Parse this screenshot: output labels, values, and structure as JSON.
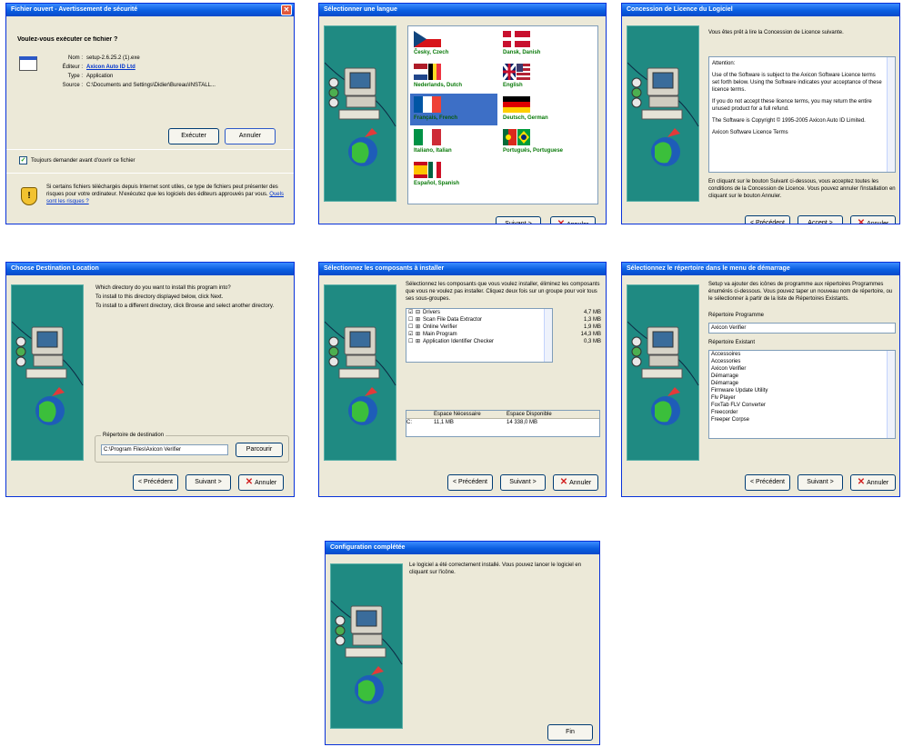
{
  "buttons": {
    "back": "< Précédent",
    "next": "Suivant >",
    "cancel": "Annuler",
    "accept": "Accept >",
    "finish": "Fin",
    "browse": "Parcourir"
  },
  "security_dialog": {
    "title": "Fichier ouvert - Avertissement de sécurité",
    "question": "Voulez-vous exécuter ce fichier ?",
    "fields": [
      {
        "label": "Nom :",
        "value": "setup-2.6.25.2 (1).exe"
      },
      {
        "label": "Éditeur :",
        "value": "Axicon Auto ID Ltd"
      },
      {
        "label": "Type :",
        "value": "Application"
      },
      {
        "label": "Source :",
        "value": "C:\\Documents and Settings\\Didier\\Bureau\\INSTALL..."
      }
    ],
    "run_label": "Exécuter",
    "cancel_label": "Annuler",
    "checkbox_label": "Toujours demander avant d'ouvrir ce fichier",
    "warning_text": "Si certains fichiers téléchargés depuis Internet sont utiles, ce type de fichiers peut présenter des risques pour votre ordinateur. N'exécutez que les logiciels des éditeurs approuvés par vous.",
    "warning_link": "Quels sont les risques ?"
  },
  "language_dialog": {
    "title": "Sélectionner une langue",
    "languages": [
      "Česky, Czech",
      "Dansk, Danish",
      "Nederlands, Dutch",
      "English",
      "Français, French",
      "Deutsch, German",
      "Italiano, Italian",
      "Português, Portuguese",
      "Español, Spanish"
    ]
  },
  "license_dialog": {
    "title": "Concession de Licence du Logiciel",
    "intro": "Vous êtes prêt à lire la Concession de Licence suivante.",
    "license_lines": [
      "Attention:",
      "Use of the Software is subject to the Axicon Software Licence terms set forth below. Using the Software indicates your acceptance of these licence terms.",
      "If you do not accept these licence terms, you may return the entire unused product for a full refund.",
      "The Software is Copyright © 1995-2005 Axicon Auto ID Limited.",
      "Axicon Software Licence Terms"
    ],
    "footer": "En cliquant sur le bouton Suivant ci-dessous, vous acceptez toutes les conditions de la Concession de Licence. Vous pouvez annuler l'installation en cliquant sur le bouton Annuler."
  },
  "destination_dialog": {
    "title": "Choose Destination Location",
    "lines": [
      "Which directory do you want to install this program into?",
      "To install to this directory displayed below, click Next.",
      "To install to a different directory, click Browse and select another directory."
    ],
    "group_label": "Répertoire de destination",
    "path": "C:\\Program Files\\Axicon Verifier"
  },
  "components_dialog": {
    "title": "Sélectionnez les composants à installer",
    "intro": "Sélectionnez les composants que vous voulez installer, éliminez les composants que vous ne voulez pas installer. Cliquez deux fois sur un groupe pour voir tous ses sous-groupes.",
    "components": [
      {
        "name": "Drivers",
        "size": "4,7 MB"
      },
      {
        "name": "Scan File Data Extractor",
        "size": "1,3 MB"
      },
      {
        "name": "Online Verifier",
        "size": "1,9 MB"
      },
      {
        "name": "Main Program",
        "size": "14,3 MB"
      },
      {
        "name": "Application Identifier Checker",
        "size": "0,3 MB"
      }
    ],
    "table_headers": [
      "",
      "Espace Nécessaire",
      "Espace Disponible"
    ],
    "table_row": [
      "C:",
      "11,1 MB",
      "14 338,0 MB"
    ]
  },
  "startmenu_dialog": {
    "title": "Sélectionnez le répertoire dans le menu de démarrage",
    "intro": "Setup va ajouter des icônes de programme aux répertoires Programmes énumérés ci-dessous. Vous pouvez taper un nouveau nom de répertoire, ou le sélectionner à partir de la liste de Répertoires Existants.",
    "program_label": "Répertoire Programme",
    "program_value": "Axicon Verifier",
    "existing_label": "Répertoire Existant",
    "existing": [
      "Accessoires",
      "Accessories",
      "Axicon Verifier",
      "Démarrage",
      "Démarrage",
      "Firmware Update Utility",
      "Flv Player",
      "FoxTab FLV Converter",
      "Freecorder",
      "Freeper Corpse"
    ]
  },
  "complete_dialog": {
    "title": "Configuration complétée",
    "text": "Le logiciel a été correctement installé. Vous pouvez lancer le logiciel en cliquant sur l'icône."
  },
  "colors": {
    "title_bar": "#0a5ee0",
    "dialog_bg": "#ece9d8",
    "side_panel": "#1f8a82",
    "link": "#0a7a0a"
  }
}
